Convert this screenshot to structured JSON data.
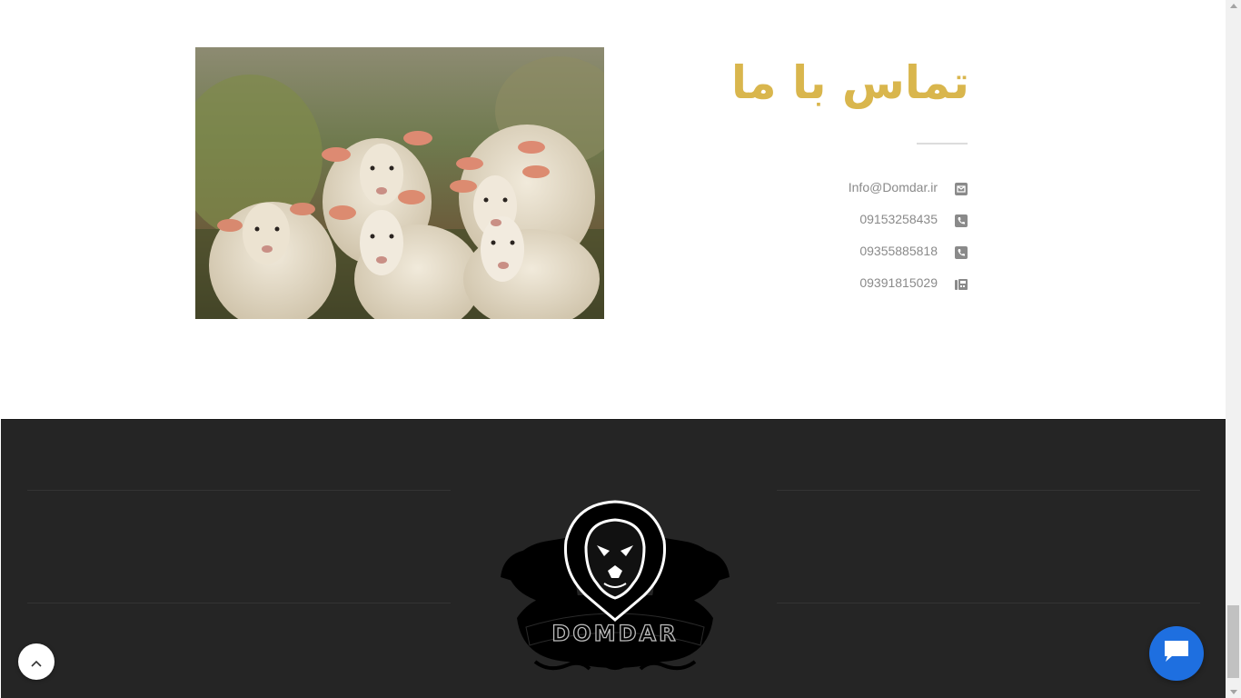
{
  "contact": {
    "title": "تماس با ما",
    "items": [
      {
        "icon": "envelope-icon",
        "text": "Info@Domdar.ir"
      },
      {
        "icon": "phone-icon",
        "text": "09153258435"
      },
      {
        "icon": "phone-icon",
        "text": "09355885818"
      },
      {
        "icon": "fax-icon",
        "text": "09391815029"
      }
    ],
    "image": {
      "subject": "sheep-photo"
    }
  },
  "footer": {
    "logo_text": "DOMDAR",
    "logo_icon": "lion-crest-icon"
  },
  "floating": {
    "back_to_top_icon": "chevron-up-icon",
    "chat_icon": "chat-bubble-icon"
  },
  "colors": {
    "title_gold": "#d9b64d",
    "footer_bg": "#252525",
    "contact_text": "#8a8a8a",
    "chat_blue": "#1e6fe0"
  }
}
